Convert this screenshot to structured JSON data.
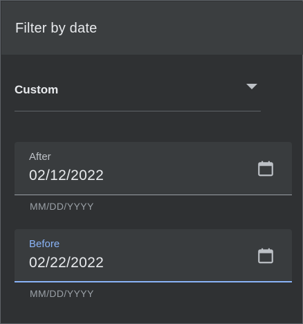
{
  "dialog": {
    "title": "Filter by date"
  },
  "range_select": {
    "selected": "Custom"
  },
  "after_field": {
    "label": "After",
    "value": "02/12/2022",
    "hint": "MM/DD/YYYY",
    "icon": "calendar-icon"
  },
  "before_field": {
    "label": "Before",
    "value": "02/22/2022",
    "hint": "MM/DD/YYYY",
    "icon": "calendar-icon",
    "focused": true
  },
  "colors": {
    "background": "#2f3133",
    "header": "#3b3e40",
    "field_fill": "#393c3e",
    "accent": "#8ab4f8",
    "text": "#e8eaed",
    "muted_text": "#9aa0a6"
  }
}
